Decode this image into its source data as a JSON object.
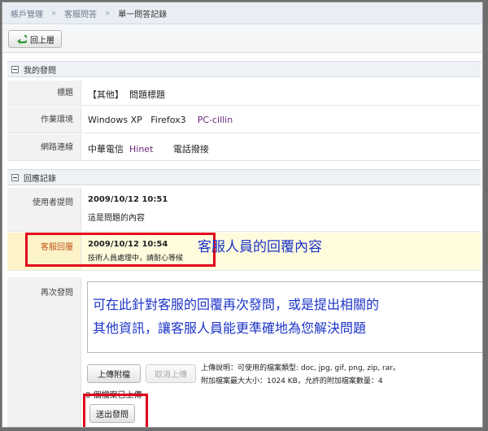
{
  "breadcrumb": {
    "items": [
      "帳戶管理",
      "客服問答",
      "單一問答記錄"
    ],
    "separator": "»"
  },
  "toolbar": {
    "back_label": "回上層"
  },
  "section_question": {
    "title": "我的發問",
    "subject_label": "標題",
    "subject_tag": "【其他】",
    "subject_value": "問題標題",
    "env_label": "作業環境",
    "env_os": "Windows XP",
    "env_browser": "Firefox3",
    "env_product": "PC-cillin",
    "network_label": "網路連線",
    "network_isp": "中華電信",
    "network_brand": "Hinet",
    "network_type": "電話撥接"
  },
  "section_reply": {
    "title": "回應記錄",
    "user_label": "使用者提問",
    "user_time": "2009/10/12 10:51",
    "user_text": "這是問題的內容",
    "cs_label": "客服回覆",
    "cs_time": "2009/10/12 10:54",
    "cs_text": "技術人員處理中，請耐心等候",
    "followup_label": "再次發問"
  },
  "annotations": {
    "reply_caption": "客服人員的回覆內容",
    "followup_line1": "可在此針對客服的回覆再次發問，或是提出相關的",
    "followup_line2": "其他資訊，讓客服人員能更準確地為您解決問題"
  },
  "upload": {
    "upload_label": "上傳附檔",
    "cancel_label": "取消上傳",
    "info_line1": "上傳說明：可使用的檔案類型: doc, jpg, gif, png, zip, rar。",
    "info_line2": "附加檔案最大大小：1024 KB，允許的附加檔案數量：4",
    "count_text": "0 個檔案已上傳",
    "submit_label": "送出發問"
  },
  "colors": {
    "annotation_red": "#e0001a",
    "annotation_blue": "#1d34c8",
    "link_purple": "#6a2a7a"
  }
}
